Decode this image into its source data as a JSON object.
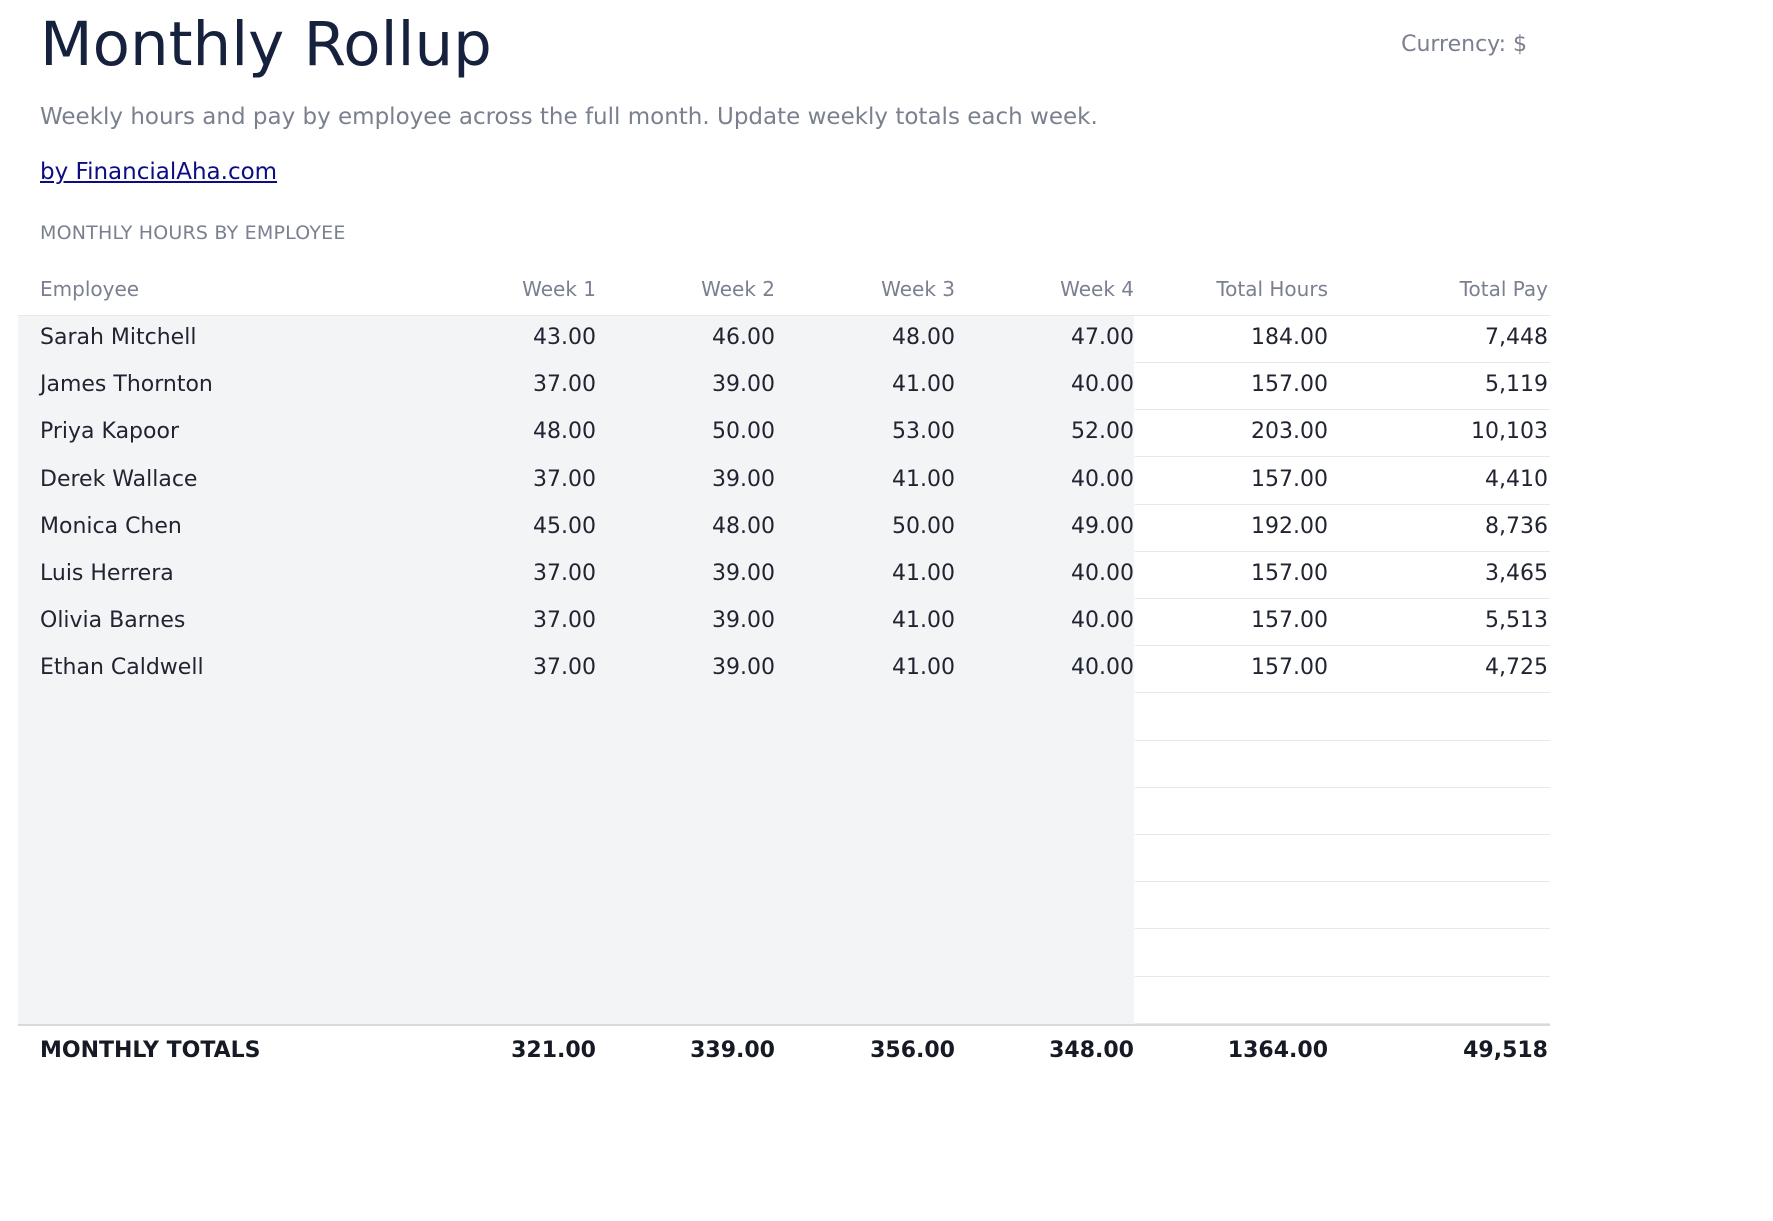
{
  "header": {
    "title": "Monthly Rollup",
    "currency": "Currency: $",
    "subtitle": "Weekly hours and pay by employee across the full month. Update weekly totals each week.",
    "byline": "by FinancialAha.com"
  },
  "section_label": "MONTHLY HOURS BY EMPLOYEE",
  "table": {
    "columns": [
      "Employee",
      "Week 1",
      "Week 2",
      "Week 3",
      "Week 4",
      "Total Hours",
      "Total Pay"
    ],
    "rows": [
      [
        "Sarah Mitchell",
        "43.00",
        "46.00",
        "48.00",
        "47.00",
        "184.00",
        "7,448"
      ],
      [
        "James Thornton",
        "37.00",
        "39.00",
        "41.00",
        "40.00",
        "157.00",
        "5,119"
      ],
      [
        "Priya Kapoor",
        "48.00",
        "50.00",
        "53.00",
        "52.00",
        "203.00",
        "10,103"
      ],
      [
        "Derek Wallace",
        "37.00",
        "39.00",
        "41.00",
        "40.00",
        "157.00",
        "4,410"
      ],
      [
        "Monica Chen",
        "45.00",
        "48.00",
        "50.00",
        "49.00",
        "192.00",
        "8,736"
      ],
      [
        "Luis Herrera",
        "37.00",
        "39.00",
        "41.00",
        "40.00",
        "157.00",
        "3,465"
      ],
      [
        "Olivia Barnes",
        "37.00",
        "39.00",
        "41.00",
        "40.00",
        "157.00",
        "5,513"
      ],
      [
        "Ethan Caldwell",
        "37.00",
        "39.00",
        "41.00",
        "40.00",
        "157.00",
        "4,725"
      ],
      [
        "",
        "",
        "",
        "",
        "",
        "",
        ""
      ],
      [
        "",
        "",
        "",
        "",
        "",
        "",
        ""
      ],
      [
        "",
        "",
        "",
        "",
        "",
        "",
        ""
      ],
      [
        "",
        "",
        "",
        "",
        "",
        "",
        ""
      ],
      [
        "",
        "",
        "",
        "",
        "",
        "",
        ""
      ],
      [
        "",
        "",
        "",
        "",
        "",
        "",
        ""
      ],
      [
        "",
        "",
        "",
        "",
        "",
        "",
        ""
      ]
    ],
    "totals": [
      "MONTHLY TOTALS",
      "321.00",
      "339.00",
      "356.00",
      "348.00",
      "1364.00",
      "49,518"
    ]
  }
}
